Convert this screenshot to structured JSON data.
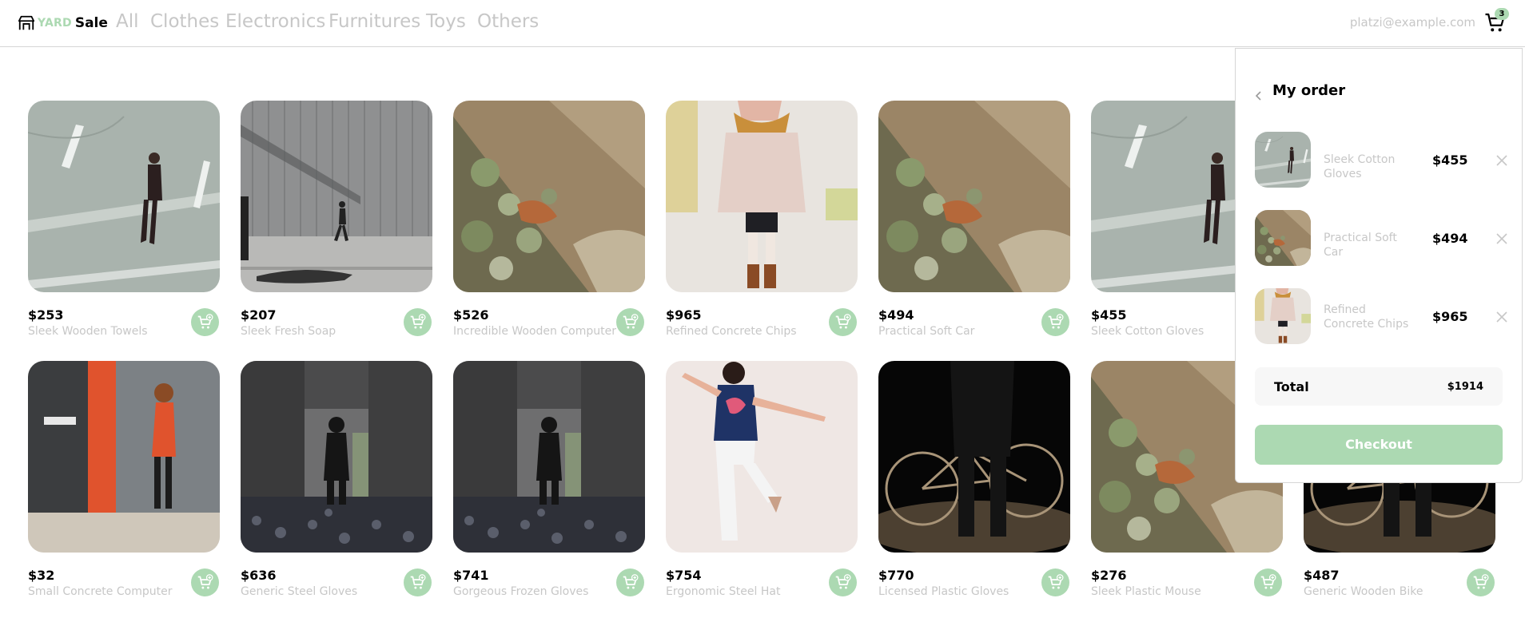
{
  "brand": {
    "yard": "YARD",
    "sale": "Sale"
  },
  "nav": {
    "links": [
      "All",
      "Clothes",
      "Electronics",
      "Furnitures",
      "Toys",
      "Others"
    ]
  },
  "account": {
    "email": "platzi@example.com"
  },
  "cart": {
    "count": "3",
    "icon": "cart-icon"
  },
  "products": [
    {
      "price": "$253",
      "name": "Sleek Wooden Towels",
      "image": "man-walking-crosswalk"
    },
    {
      "price": "$207",
      "name": "Sleek Fresh Soap",
      "image": "man-walking-gray-wall"
    },
    {
      "price": "$526",
      "name": "Incredible Wooden Computer",
      "image": "rock-lichen"
    },
    {
      "price": "$965",
      "name": "Refined Concrete Chips",
      "image": "woman-coat-scarf"
    },
    {
      "price": "$494",
      "name": "Practical Soft Car",
      "image": "rock-lichen"
    },
    {
      "price": "$455",
      "name": "Sleek Cotton Gloves",
      "image": "man-walking-crosswalk"
    },
    {
      "price": "$32",
      "name": "Small Concrete Computer",
      "image": "woman-phone-red-wall"
    },
    {
      "price": "$636",
      "name": "Generic Steel Gloves",
      "image": "dark-concrete-figure"
    },
    {
      "price": "$741",
      "name": "Gorgeous Frozen Gloves",
      "image": "dark-concrete-figure"
    },
    {
      "price": "$754",
      "name": "Ergonomic Steel Hat",
      "image": "woman-jumping"
    },
    {
      "price": "$770",
      "name": "Licensed Plastic Gloves",
      "image": "bicycle-silhouette"
    },
    {
      "price": "$276",
      "name": "Sleek Plastic Mouse",
      "image": "rock-lichen"
    },
    {
      "price": "$487",
      "name": "Generic Wooden Bike",
      "image": "bicycle-silhouette"
    }
  ],
  "order": {
    "title": "My order",
    "items": [
      {
        "name": "Sleek Cotton Gloves",
        "price": "$455",
        "image": "man-walking-crosswalk"
      },
      {
        "name": "Practical Soft Car",
        "price": "$494",
        "image": "rock-lichen"
      },
      {
        "name": "Refined Concrete Chips",
        "price": "$965",
        "image": "woman-coat-scarf"
      }
    ],
    "total_label": "Total",
    "total_value": "$1914",
    "checkout_label": "Checkout"
  },
  "colors": {
    "accent": "#acd9b2",
    "muted_text": "#c7c7c7",
    "border": "#d6d6d6"
  }
}
